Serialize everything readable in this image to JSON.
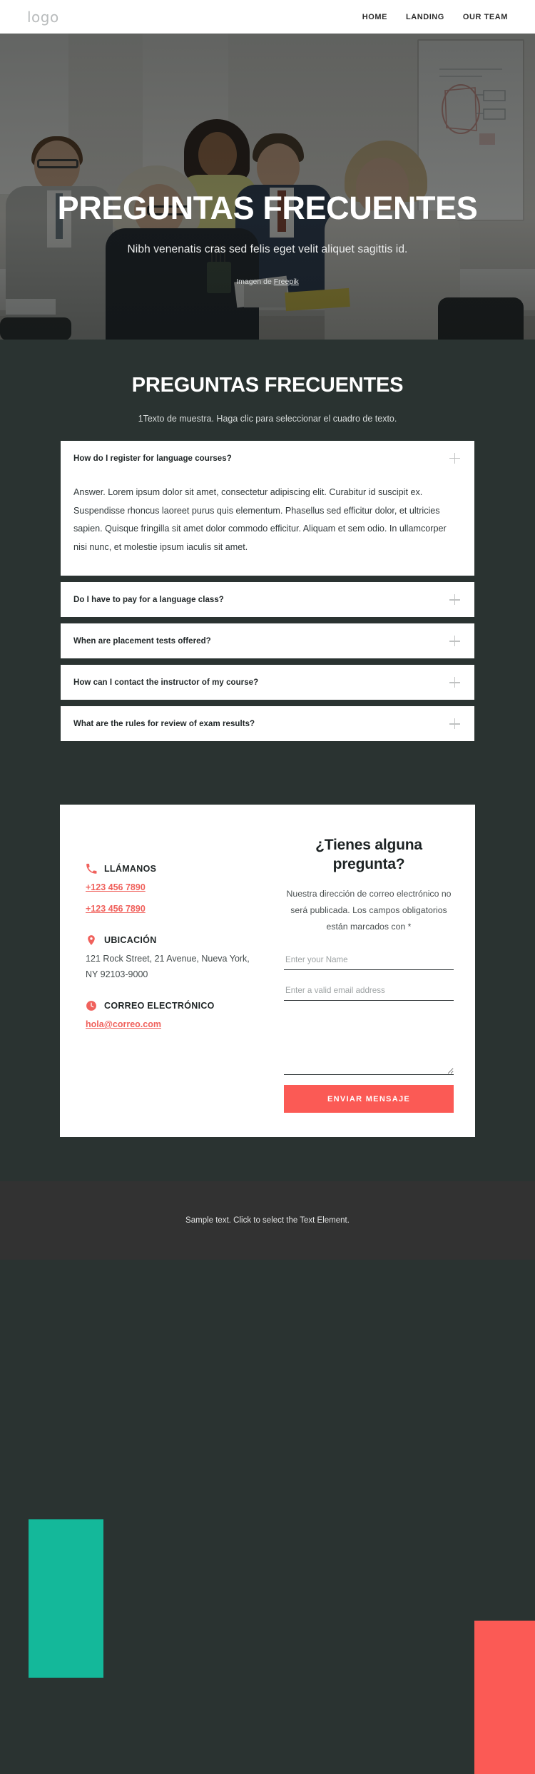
{
  "header": {
    "logo": "logo",
    "nav": [
      {
        "label": "HOME"
      },
      {
        "label": "LANDING"
      },
      {
        "label": "OUR TEAM"
      }
    ]
  },
  "hero": {
    "title": "PREGUNTAS FRECUENTES",
    "subtitle": "Nibh venenatis cras sed felis eget velit aliquet sagittis id.",
    "credit_prefix": "Imagen de ",
    "credit_link": "Freepik"
  },
  "faq": {
    "title": "PREGUNTAS FRECUENTES",
    "subtitle": "1Texto de muestra. Haga clic para seleccionar el cuadro de texto.",
    "items": [
      {
        "question": "How do I register for language courses?",
        "answer": "Answer. Lorem ipsum dolor sit amet, consectetur adipiscing elit. Curabitur id suscipit ex. Suspendisse rhoncus laoreet purus quis elementum. Phasellus sed efficitur dolor, et ultricies sapien. Quisque fringilla sit amet dolor commodo efficitur. Aliquam et sem odio. In ullamcorper nisi nunc, et molestie ipsum iaculis sit amet.",
        "expanded": true,
        "toggle_icon": "plus-icon"
      },
      {
        "question": "Do I have to pay for a language class?",
        "answer": "",
        "expanded": false,
        "toggle_icon": "plus-icon"
      },
      {
        "question": "When are placement tests offered?",
        "answer": "",
        "expanded": false,
        "toggle_icon": "plus-icon"
      },
      {
        "question": "How can I contact the instructor of my course?",
        "answer": "",
        "expanded": false,
        "toggle_icon": "plus-icon"
      },
      {
        "question": "What are the rules for review of exam results?",
        "answer": "",
        "expanded": false,
        "toggle_icon": "plus-icon"
      }
    ]
  },
  "contact": {
    "phone": {
      "icon": "phone-icon",
      "label": "LLÁMANOS",
      "value1": "+123 456 7890",
      "value2": "+123 456 7890"
    },
    "location": {
      "icon": "map-pin-icon",
      "label": "UBICACIÓN",
      "line1": "121 Rock Street, 21 Avenue, Nueva York,",
      "line2": "NY 92103-9000"
    },
    "email": {
      "icon": "clock-icon",
      "label": "CORREO ELECTRÓNICO",
      "value": "hola@correo.com"
    }
  },
  "form": {
    "title": "¿Tienes alguna pregunta?",
    "description": "Nuestra dirección de correo electrónico no será publicada. Los campos obligatorios están marcados con *",
    "name_placeholder": "Enter your Name",
    "name_value": "",
    "email_placeholder": "Enter a valid email address",
    "email_value": "",
    "message_placeholder": "",
    "message_value": "",
    "submit_label": "ENVIAR MENSAJE"
  },
  "footer": {
    "text": "Sample text. Click to select the Text Element."
  },
  "colors": {
    "dark_bg": "#2a3331",
    "footer_bg": "#323232",
    "accent_red": "#fb5a55",
    "accent_teal": "#14b89a",
    "link_red": "#f0615c"
  }
}
